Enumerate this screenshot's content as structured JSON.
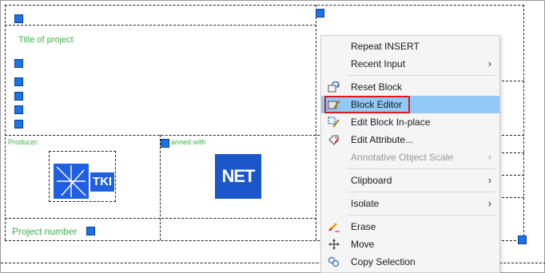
{
  "drawing": {
    "title_text": "Title of project",
    "producer_text": "Producer:",
    "planned_text": "anned with",
    "project_number_text": "Project number",
    "logo_tki_text": "TKI",
    "logo_net_text": "NET"
  },
  "context_menu": {
    "items": [
      {
        "label": "Repeat INSERT",
        "icon": "",
        "submenu": false,
        "disabled": false,
        "highlighted": false
      },
      {
        "label": "Recent Input",
        "icon": "",
        "submenu": true,
        "disabled": false,
        "highlighted": false
      },
      {
        "label": "Reset Block",
        "icon": "reset-block-icon",
        "submenu": false,
        "disabled": false,
        "highlighted": false
      },
      {
        "label": "Block Editor",
        "icon": "block-editor-icon",
        "submenu": false,
        "disabled": false,
        "highlighted": true
      },
      {
        "label": "Edit Block In-place",
        "icon": "edit-block-inplace-icon",
        "submenu": false,
        "disabled": false,
        "highlighted": false
      },
      {
        "label": "Edit Attribute...",
        "icon": "edit-attribute-icon",
        "submenu": false,
        "disabled": false,
        "highlighted": false
      },
      {
        "label": "Annotative Object Scale",
        "icon": "",
        "submenu": true,
        "disabled": true,
        "highlighted": false
      },
      {
        "label": "Clipboard",
        "icon": "",
        "submenu": true,
        "disabled": false,
        "highlighted": false
      },
      {
        "label": "Isolate",
        "icon": "",
        "submenu": true,
        "disabled": false,
        "highlighted": false
      },
      {
        "label": "Erase",
        "icon": "erase-icon",
        "submenu": false,
        "disabled": false,
        "highlighted": false
      },
      {
        "label": "Move",
        "icon": "move-icon",
        "submenu": false,
        "disabled": false,
        "highlighted": false
      },
      {
        "label": "Copy Selection",
        "icon": "copy-selection-icon",
        "submenu": false,
        "disabled": false,
        "highlighted": false
      }
    ],
    "submenu_arrow": "›"
  },
  "colors": {
    "grip": "#1a73e8",
    "highlight": "#91c9f7",
    "focus_border": "#e01818",
    "attribute_text": "#39b54a"
  }
}
